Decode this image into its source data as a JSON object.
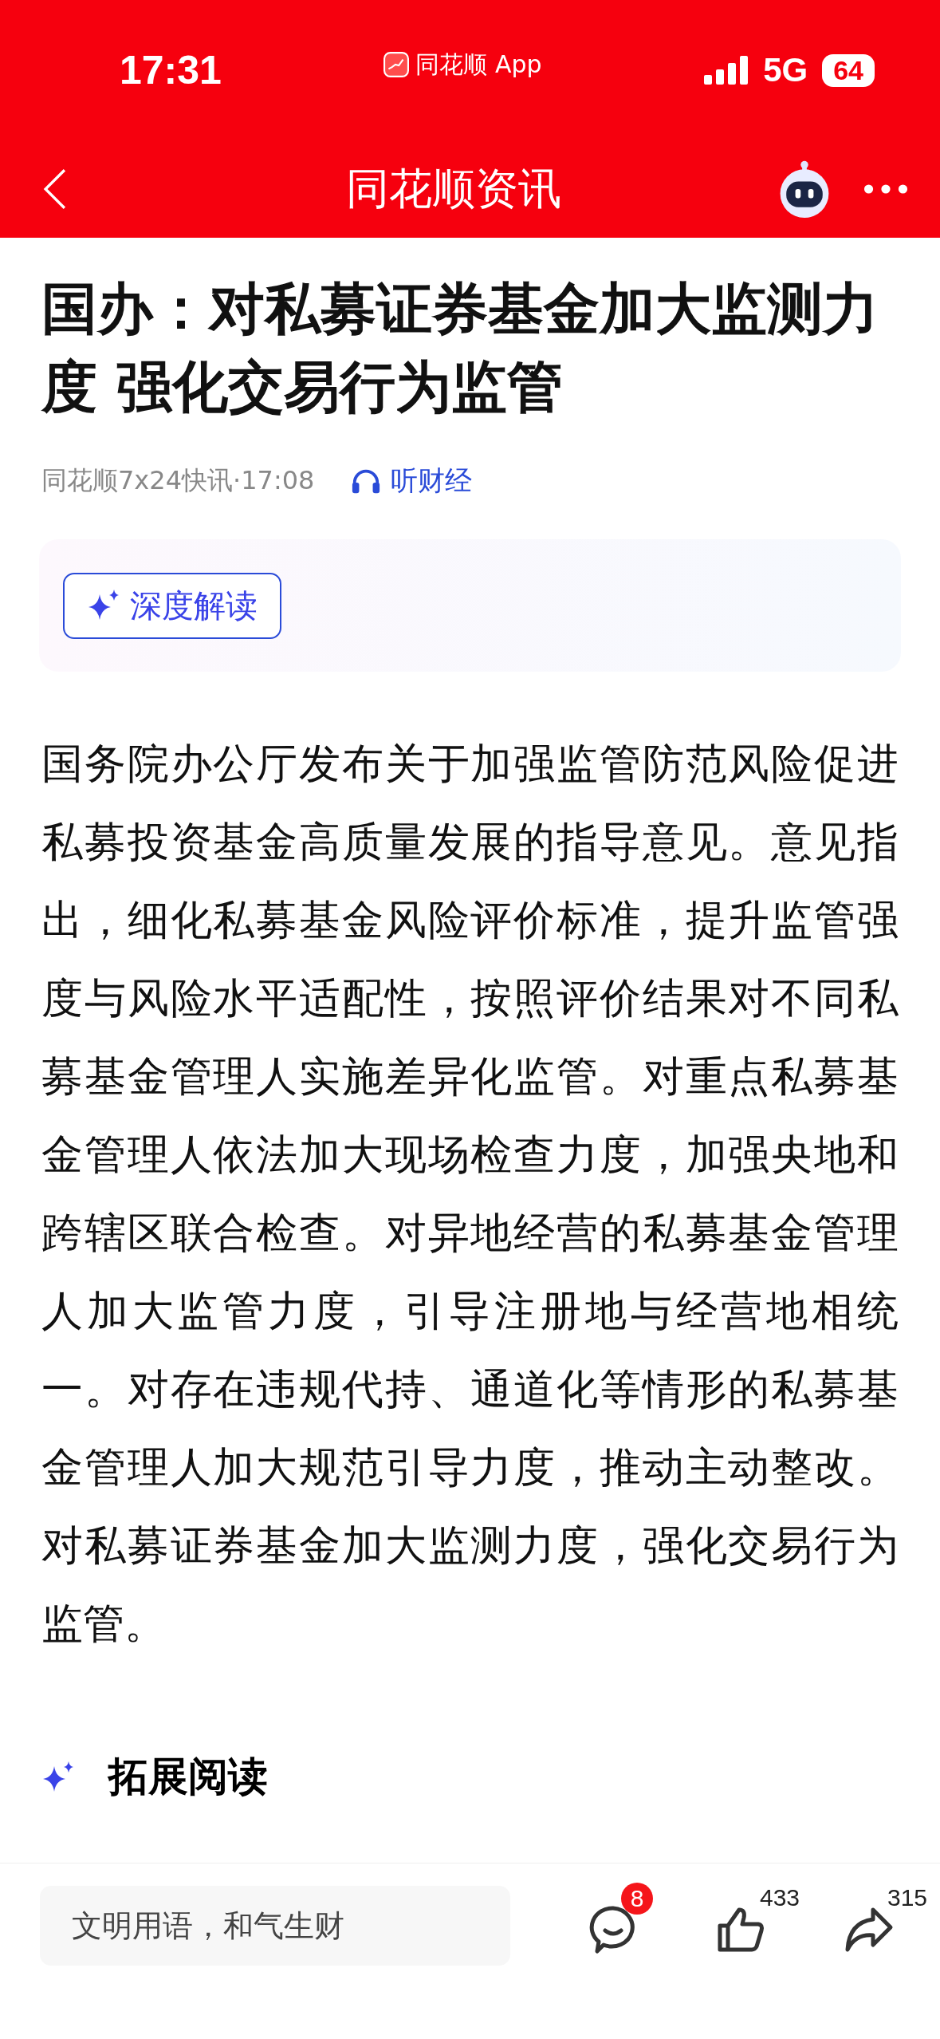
{
  "status_bar": {
    "time": "17:31",
    "app_label": "同花顺 App",
    "network": "5G",
    "battery": "64"
  },
  "nav": {
    "title": "同花顺资讯"
  },
  "article": {
    "title": "国办：对私募证券基金加大监测力度 强化交易行为监管",
    "source": "同花顺7x24快讯·17:08",
    "listen": "听财经",
    "ai_button": "深度解读",
    "body": "国务院办公厅发布关于加强监管防范风险促进私募投资基金高质量发展的指导意见。意见指出，细化私募基金风险评价标准，提升监管强度与风险水平适配性，按照评价结果对不同私募基金管理人实施差异化监管。对重点私募基金管理人依法加大现场检查力度，加强央地和跨辖区联合检查。对异地经营的私募基金管理人加大监管力度，引导注册地与经营地相统一。对存在违规代持、通道化等情形的私募基金管理人加大规范引导力度，推动主动整改。对私募证券基金加大监测力度，强化交易行为监管。",
    "related_heading": "拓展阅读"
  },
  "bottom_bar": {
    "placeholder": "文明用语，和气生财",
    "comment_badge": "8",
    "likes": "433",
    "shares": "315"
  }
}
